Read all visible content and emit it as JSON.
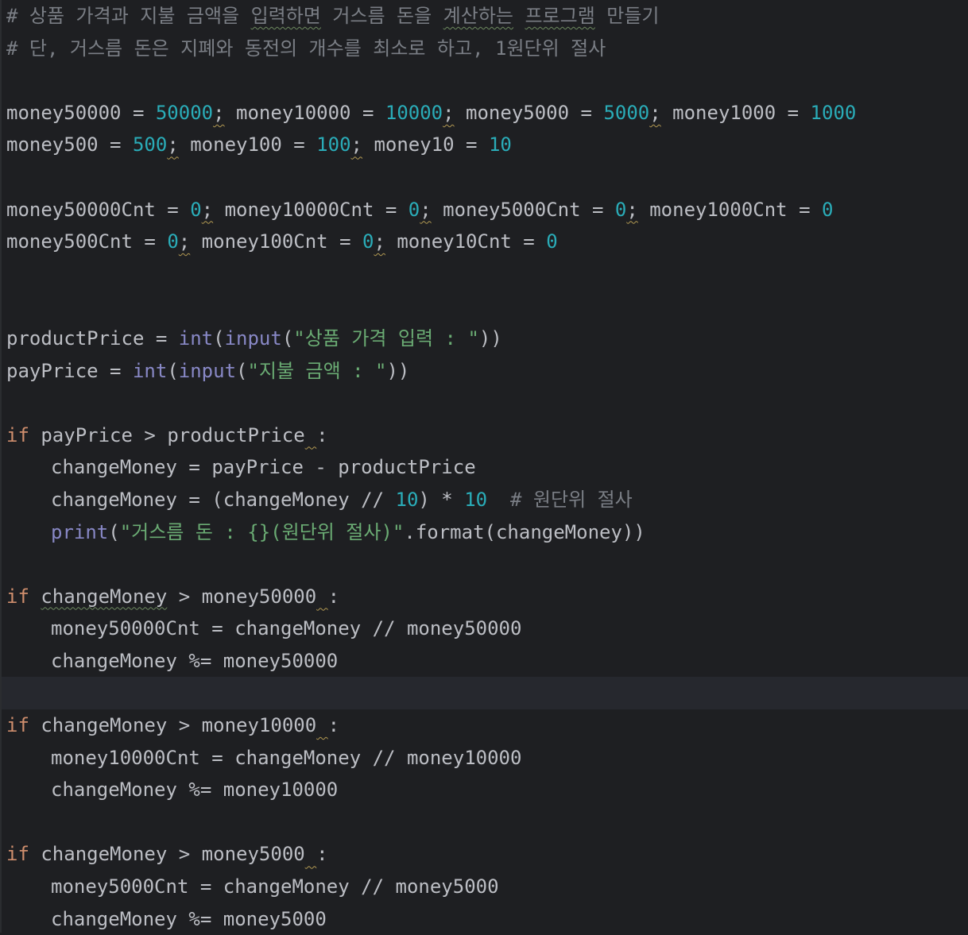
{
  "editor": {
    "line1": {
      "hash": "#",
      "w1": "상품",
      "w2": "가격과",
      "w3": "지불",
      "w4": "금액을",
      "w5": "입력하면",
      "w6": "거스름",
      "w7": "돈을",
      "w8": "계산하는",
      "w9": "프로그램",
      "w10": "만들기"
    },
    "line2": "# 단, 거스름 돈은 지폐와 동전의 개수를 최소로 하고, 1원단위 절사",
    "line4": {
      "a_name": "money50000",
      "a_val": "50000",
      "b_name": "money10000",
      "b_val": "10000",
      "c_name": "money5000",
      "c_val": "5000",
      "d_name": "money1000",
      "d_val": "1000"
    },
    "line5": {
      "a_name": "money500",
      "a_val": "500",
      "b_name": "money100",
      "b_val": "100",
      "c_name": "money10",
      "c_val": "10"
    },
    "line7": {
      "a_name": "money50000Cnt",
      "a_val": "0",
      "b_name": "money10000Cnt",
      "b_val": "0",
      "c_name": "money5000Cnt",
      "c_val": "0",
      "d_name": "money1000Cnt",
      "d_val": "0"
    },
    "line8": {
      "a_name": "money500Cnt",
      "a_val": "0",
      "b_name": "money100Cnt",
      "b_val": "0",
      "c_name": "money10Cnt",
      "c_val": "0"
    },
    "line11": {
      "var": "productPrice",
      "fn_int": "int",
      "fn_input": "input",
      "str": "\"상품 가격 입력 : \""
    },
    "line12": {
      "var": "payPrice",
      "fn_int": "int",
      "fn_input": "input",
      "str": "\"지불 금액 : \""
    },
    "line14": {
      "kw": "if",
      "left": "payPrice",
      "right": "productPrice"
    },
    "line15": {
      "var": "changeMoney",
      "left": "payPrice",
      "right": "productPrice"
    },
    "line16": {
      "var": "changeMoney",
      "inner": "changeMoney",
      "num1": "10",
      "num2": "10",
      "comment": "# 원단위 절사"
    },
    "line17": {
      "fn": "print",
      "str": "\"거스름 돈 : {}(원단위 절사)\"",
      "method": "format",
      "arg": "changeMoney"
    },
    "line19": {
      "kw": "if",
      "left": "changeMoney",
      "right": "money50000"
    },
    "line20": {
      "var": "money50000Cnt",
      "left": "changeMoney",
      "right": "money50000"
    },
    "line21": {
      "var": "changeMoney",
      "right": "money50000"
    },
    "line23": {
      "kw": "if",
      "left": "changeMoney",
      "right": "money10000"
    },
    "line24": {
      "var": "money10000Cnt",
      "left": "changeMoney",
      "right": "money10000"
    },
    "line25": {
      "var": "changeMoney",
      "right": "money10000"
    },
    "line27": {
      "kw": "if",
      "left": "changeMoney",
      "right": "money5000"
    },
    "line28": {
      "var": "money5000Cnt",
      "left": "changeMoney",
      "right": "money5000"
    },
    "line29": {
      "var": "changeMoney",
      "right": "money5000"
    }
  },
  "colors": {
    "background": "#1e1f22",
    "comment": "#7a7e85",
    "number": "#2aacb8",
    "keyword": "#cf8e6d",
    "builtin": "#8888c6",
    "string": "#6aab73",
    "identifier": "#bcbec4"
  }
}
